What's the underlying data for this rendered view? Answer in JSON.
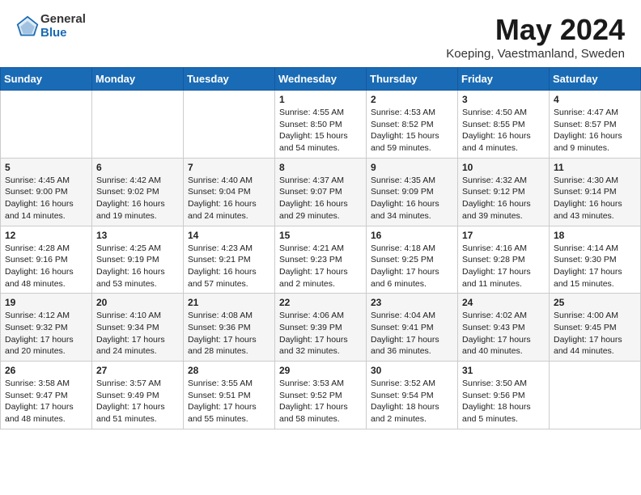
{
  "header": {
    "logo": {
      "general": "General",
      "blue": "Blue"
    },
    "title": "May 2024",
    "subtitle": "Koeping, Vaestmanland, Sweden"
  },
  "weekdays": [
    "Sunday",
    "Monday",
    "Tuesday",
    "Wednesday",
    "Thursday",
    "Friday",
    "Saturday"
  ],
  "weeks": [
    [
      {
        "day": "",
        "info": ""
      },
      {
        "day": "",
        "info": ""
      },
      {
        "day": "",
        "info": ""
      },
      {
        "day": "1",
        "info": "Sunrise: 4:55 AM\nSunset: 8:50 PM\nDaylight: 15 hours\nand 54 minutes."
      },
      {
        "day": "2",
        "info": "Sunrise: 4:53 AM\nSunset: 8:52 PM\nDaylight: 15 hours\nand 59 minutes."
      },
      {
        "day": "3",
        "info": "Sunrise: 4:50 AM\nSunset: 8:55 PM\nDaylight: 16 hours\nand 4 minutes."
      },
      {
        "day": "4",
        "info": "Sunrise: 4:47 AM\nSunset: 8:57 PM\nDaylight: 16 hours\nand 9 minutes."
      }
    ],
    [
      {
        "day": "5",
        "info": "Sunrise: 4:45 AM\nSunset: 9:00 PM\nDaylight: 16 hours\nand 14 minutes."
      },
      {
        "day": "6",
        "info": "Sunrise: 4:42 AM\nSunset: 9:02 PM\nDaylight: 16 hours\nand 19 minutes."
      },
      {
        "day": "7",
        "info": "Sunrise: 4:40 AM\nSunset: 9:04 PM\nDaylight: 16 hours\nand 24 minutes."
      },
      {
        "day": "8",
        "info": "Sunrise: 4:37 AM\nSunset: 9:07 PM\nDaylight: 16 hours\nand 29 minutes."
      },
      {
        "day": "9",
        "info": "Sunrise: 4:35 AM\nSunset: 9:09 PM\nDaylight: 16 hours\nand 34 minutes."
      },
      {
        "day": "10",
        "info": "Sunrise: 4:32 AM\nSunset: 9:12 PM\nDaylight: 16 hours\nand 39 minutes."
      },
      {
        "day": "11",
        "info": "Sunrise: 4:30 AM\nSunset: 9:14 PM\nDaylight: 16 hours\nand 43 minutes."
      }
    ],
    [
      {
        "day": "12",
        "info": "Sunrise: 4:28 AM\nSunset: 9:16 PM\nDaylight: 16 hours\nand 48 minutes."
      },
      {
        "day": "13",
        "info": "Sunrise: 4:25 AM\nSunset: 9:19 PM\nDaylight: 16 hours\nand 53 minutes."
      },
      {
        "day": "14",
        "info": "Sunrise: 4:23 AM\nSunset: 9:21 PM\nDaylight: 16 hours\nand 57 minutes."
      },
      {
        "day": "15",
        "info": "Sunrise: 4:21 AM\nSunset: 9:23 PM\nDaylight: 17 hours\nand 2 minutes."
      },
      {
        "day": "16",
        "info": "Sunrise: 4:18 AM\nSunset: 9:25 PM\nDaylight: 17 hours\nand 6 minutes."
      },
      {
        "day": "17",
        "info": "Sunrise: 4:16 AM\nSunset: 9:28 PM\nDaylight: 17 hours\nand 11 minutes."
      },
      {
        "day": "18",
        "info": "Sunrise: 4:14 AM\nSunset: 9:30 PM\nDaylight: 17 hours\nand 15 minutes."
      }
    ],
    [
      {
        "day": "19",
        "info": "Sunrise: 4:12 AM\nSunset: 9:32 PM\nDaylight: 17 hours\nand 20 minutes."
      },
      {
        "day": "20",
        "info": "Sunrise: 4:10 AM\nSunset: 9:34 PM\nDaylight: 17 hours\nand 24 minutes."
      },
      {
        "day": "21",
        "info": "Sunrise: 4:08 AM\nSunset: 9:36 PM\nDaylight: 17 hours\nand 28 minutes."
      },
      {
        "day": "22",
        "info": "Sunrise: 4:06 AM\nSunset: 9:39 PM\nDaylight: 17 hours\nand 32 minutes."
      },
      {
        "day": "23",
        "info": "Sunrise: 4:04 AM\nSunset: 9:41 PM\nDaylight: 17 hours\nand 36 minutes."
      },
      {
        "day": "24",
        "info": "Sunrise: 4:02 AM\nSunset: 9:43 PM\nDaylight: 17 hours\nand 40 minutes."
      },
      {
        "day": "25",
        "info": "Sunrise: 4:00 AM\nSunset: 9:45 PM\nDaylight: 17 hours\nand 44 minutes."
      }
    ],
    [
      {
        "day": "26",
        "info": "Sunrise: 3:58 AM\nSunset: 9:47 PM\nDaylight: 17 hours\nand 48 minutes."
      },
      {
        "day": "27",
        "info": "Sunrise: 3:57 AM\nSunset: 9:49 PM\nDaylight: 17 hours\nand 51 minutes."
      },
      {
        "day": "28",
        "info": "Sunrise: 3:55 AM\nSunset: 9:51 PM\nDaylight: 17 hours\nand 55 minutes."
      },
      {
        "day": "29",
        "info": "Sunrise: 3:53 AM\nSunset: 9:52 PM\nDaylight: 17 hours\nand 58 minutes."
      },
      {
        "day": "30",
        "info": "Sunrise: 3:52 AM\nSunset: 9:54 PM\nDaylight: 18 hours\nand 2 minutes."
      },
      {
        "day": "31",
        "info": "Sunrise: 3:50 AM\nSunset: 9:56 PM\nDaylight: 18 hours\nand 5 minutes."
      },
      {
        "day": "",
        "info": ""
      }
    ]
  ]
}
